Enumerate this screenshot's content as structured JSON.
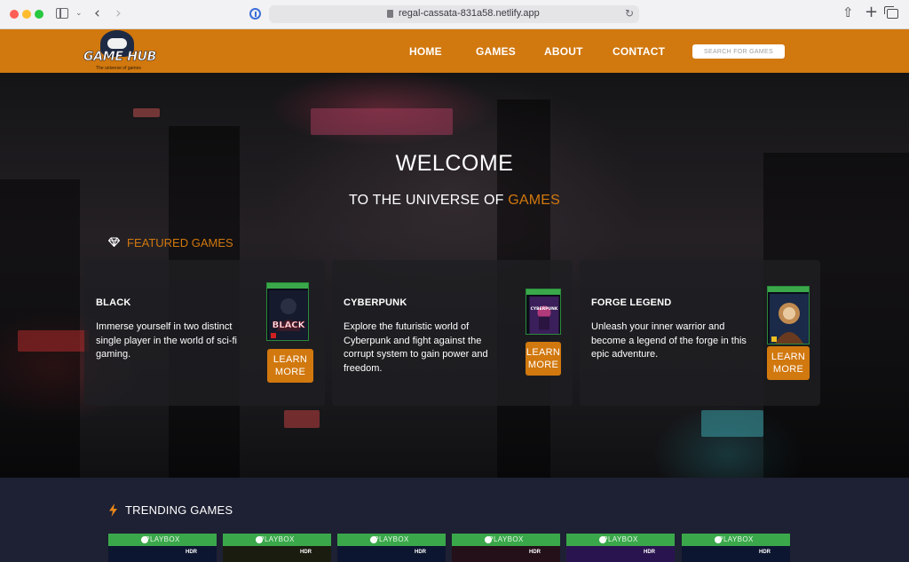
{
  "browser": {
    "url": "regal-cassata-831a58.netlify.app"
  },
  "site": {
    "logo_text": "GAME HUB",
    "logo_tagline": "The universe of games",
    "nav": {
      "home": "HOME",
      "games": "GAMES",
      "about": "ABOUT",
      "contact": "CONTACT"
    },
    "search_placeholder": "SEARCH FOR GAMES",
    "accent_color": "#d1780e"
  },
  "hero": {
    "title": "WELCOME",
    "subtitle_prefix": "TO THE UNIVERSE OF",
    "subtitle_accent": "GAMES",
    "featured_heading": "FEATURED GAMES"
  },
  "featured": [
    {
      "title": "BLACK",
      "description": "Immerse yourself in two distinct single player in the world of sci-fi gaming.",
      "button": "LEARN MORE"
    },
    {
      "title": "CYBERPUNK",
      "description": "Explore the futuristic world of Cyberpunk and fight against the corrupt system to gain power and freedom.",
      "button": "LEARN MORE"
    },
    {
      "title": "FORGE LEGEND",
      "description": "Unleash your inner warrior and become a legend of the forge in this epic adventure.",
      "button": "LEARN MORE"
    }
  ],
  "trending": {
    "heading": "TRENDING GAMES",
    "cards": [
      {
        "platform": "PLAYBOX",
        "badge": "HDR"
      },
      {
        "platform": "PLAYBOX",
        "badge": "HDR"
      },
      {
        "platform": "PLAYBOX",
        "badge": "HDR"
      },
      {
        "platform": "PLAYBOX",
        "badge": "HDR"
      },
      {
        "platform": "PLAYBOX",
        "badge": "HDR"
      },
      {
        "platform": "PLAYBOX",
        "badge": "HDR"
      }
    ]
  }
}
